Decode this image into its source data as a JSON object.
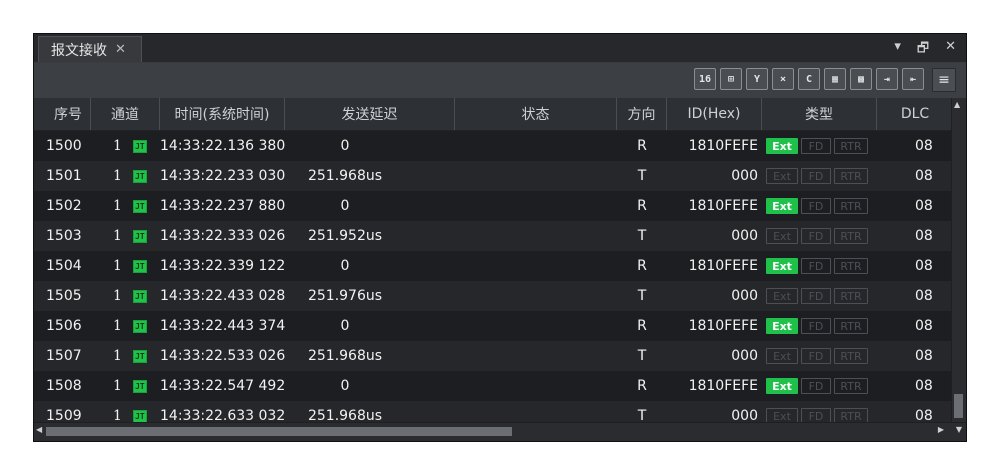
{
  "tab": {
    "title": "报文接收",
    "close": "✕"
  },
  "window_controls": {
    "dropdown": "▾",
    "float": "🗗",
    "close": "✕"
  },
  "toolbar": {
    "buttons": [
      {
        "icon": "hex-dec-toggle-icon",
        "glyph": "16"
      },
      {
        "icon": "tree-view-icon",
        "glyph": "⊞"
      },
      {
        "icon": "filter-icon",
        "glyph": "Y"
      },
      {
        "icon": "clear-icon",
        "glyph": "×"
      },
      {
        "icon": "refresh-icon",
        "glyph": "C"
      },
      {
        "icon": "format-icon",
        "glyph": "▦"
      },
      {
        "icon": "grid-icon",
        "glyph": "▩"
      },
      {
        "icon": "export-icon",
        "glyph": "⇥"
      },
      {
        "icon": "import-icon",
        "glyph": "⇤"
      }
    ],
    "menu": "≡"
  },
  "columns": [
    "序号",
    "通道",
    "时间(系统时间)",
    "发送延迟",
    "状态",
    "方向",
    "ID(Hex)",
    "类型",
    "DLC"
  ],
  "type_tags": {
    "ext": "Ext",
    "fd": "FD",
    "rtr": "RTR"
  },
  "colors": {
    "active_tag": "#1fc14a",
    "inactive_tag": "#4c4f53",
    "background": "#2b2d30"
  },
  "rows": [
    {
      "seq": "1500",
      "ch": "1",
      "time": "14:33:22.136 380",
      "delay": "0",
      "state": "",
      "dir": "R",
      "id": "1810FEFE",
      "ext": true,
      "dlc": "08"
    },
    {
      "seq": "1501",
      "ch": "1",
      "time": "14:33:22.233 030",
      "delay": "251.968us",
      "state": "",
      "dir": "T",
      "id": "000",
      "ext": false,
      "dlc": "08"
    },
    {
      "seq": "1502",
      "ch": "1",
      "time": "14:33:22.237 880",
      "delay": "0",
      "state": "",
      "dir": "R",
      "id": "1810FEFE",
      "ext": true,
      "dlc": "08"
    },
    {
      "seq": "1503",
      "ch": "1",
      "time": "14:33:22.333 026",
      "delay": "251.952us",
      "state": "",
      "dir": "T",
      "id": "000",
      "ext": false,
      "dlc": "08"
    },
    {
      "seq": "1504",
      "ch": "1",
      "time": "14:33:22.339 122",
      "delay": "0",
      "state": "",
      "dir": "R",
      "id": "1810FEFE",
      "ext": true,
      "dlc": "08"
    },
    {
      "seq": "1505",
      "ch": "1",
      "time": "14:33:22.433 028",
      "delay": "251.976us",
      "state": "",
      "dir": "T",
      "id": "000",
      "ext": false,
      "dlc": "08"
    },
    {
      "seq": "1506",
      "ch": "1",
      "time": "14:33:22.443 374",
      "delay": "0",
      "state": "",
      "dir": "R",
      "id": "1810FEFE",
      "ext": true,
      "dlc": "08"
    },
    {
      "seq": "1507",
      "ch": "1",
      "time": "14:33:22.533 026",
      "delay": "251.968us",
      "state": "",
      "dir": "T",
      "id": "000",
      "ext": false,
      "dlc": "08"
    },
    {
      "seq": "1508",
      "ch": "1",
      "time": "14:33:22.547 492",
      "delay": "0",
      "state": "",
      "dir": "R",
      "id": "1810FEFE",
      "ext": true,
      "dlc": "08"
    },
    {
      "seq": "1509",
      "ch": "1",
      "time": "14:33:22.633 032",
      "delay": "251.968us",
      "state": "",
      "dir": "T",
      "id": "000",
      "ext": false,
      "dlc": "08"
    }
  ]
}
